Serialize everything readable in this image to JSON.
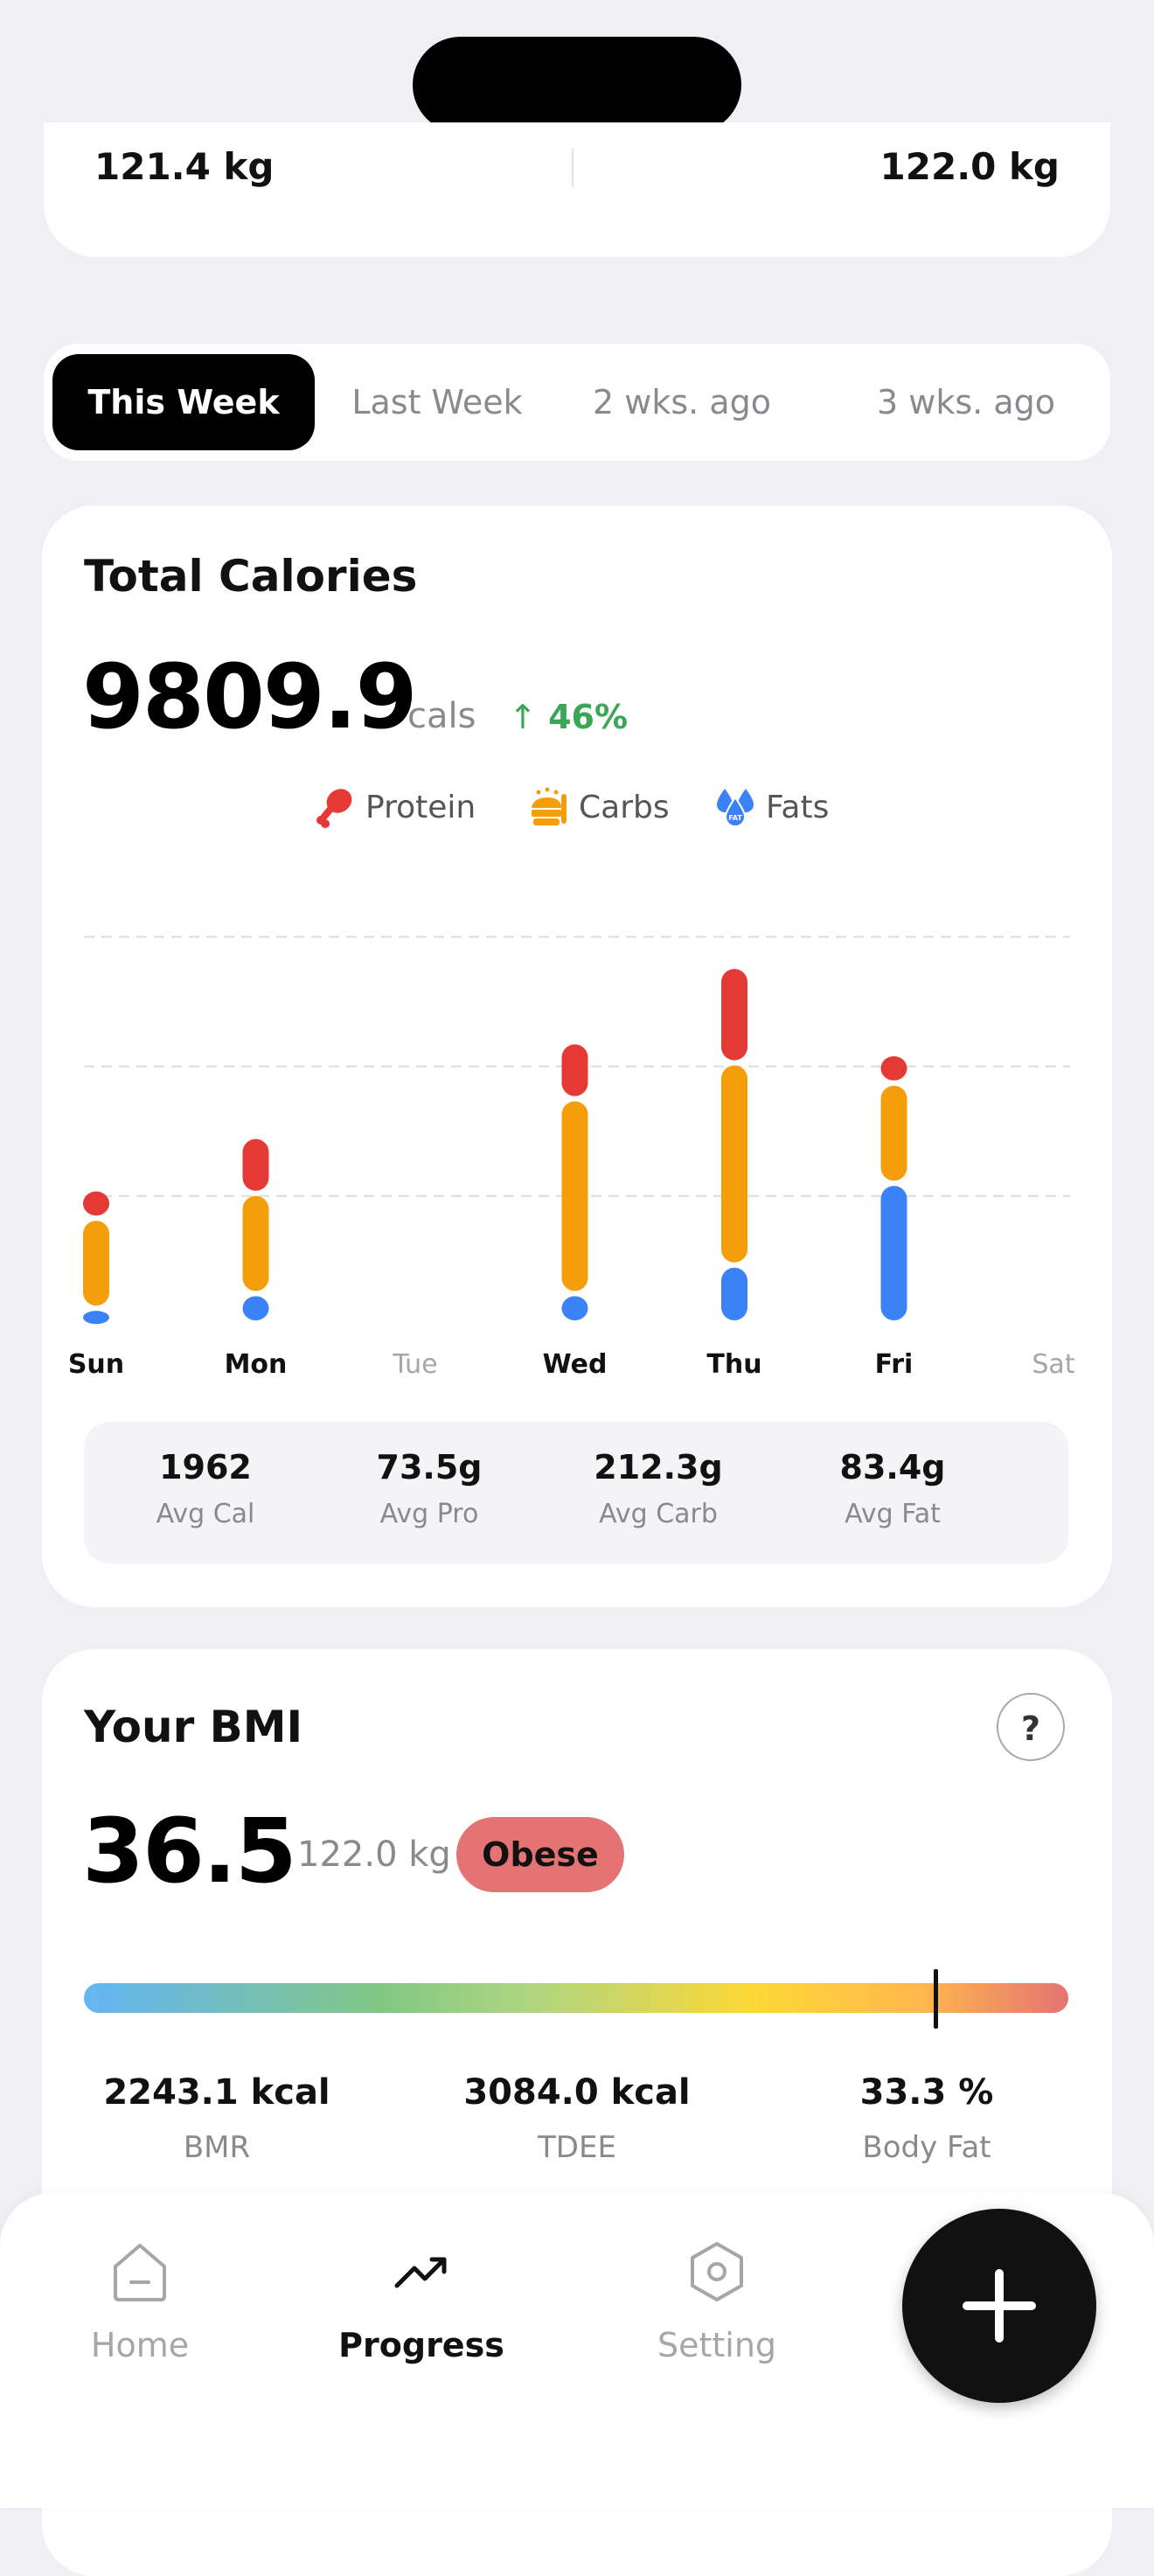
{
  "weight": {
    "left_value": "121.4 kg",
    "right_value": "122.0 kg"
  },
  "tabs": [
    {
      "label": "This Week",
      "active": true
    },
    {
      "label": "Last Week",
      "active": false
    },
    {
      "label": "2 wks. ago",
      "active": false
    },
    {
      "label": "3 wks. ago",
      "active": false
    }
  ],
  "calories": {
    "title": "Total Calories",
    "total": "9809.9",
    "unit": "cals",
    "delta": "46%",
    "delta_direction": "up",
    "legend": [
      {
        "label": "Protein",
        "icon": "drumstick-icon",
        "color": "#e53935"
      },
      {
        "label": "Carbs",
        "icon": "bread-icon",
        "color": "#f59e0b"
      },
      {
        "label": "Fats",
        "icon": "fat-drops-icon",
        "color": "#3b82f6"
      }
    ],
    "stats": [
      {
        "value": "1962",
        "label": "Avg Cal"
      },
      {
        "value": "73.5g",
        "label": "Avg Pro"
      },
      {
        "value": "212.3g",
        "label": "Avg Carb"
      },
      {
        "value": "83.4g",
        "label": "Avg Fat"
      }
    ]
  },
  "chart_data": {
    "type": "bar",
    "stacked": true,
    "categories": [
      "Sun",
      "Mon",
      "Tue",
      "Wed",
      "Thu",
      "Fri",
      "Sat"
    ],
    "series": [
      {
        "name": "Fats",
        "color": "#3b82f6",
        "values": [
          80,
          160,
          0,
          160,
          315,
          760
        ]
      },
      {
        "name": "Carbs",
        "color": "#f59e0b",
        "values": [
          490,
          545,
          0,
          1060,
          1100,
          545
        ]
      },
      {
        "name": "Protein",
        "color": "#e53935",
        "values": [
          160,
          310,
          0,
          310,
          525,
          160
        ]
      }
    ],
    "ylim": [
      0,
      2150
    ],
    "gridlines": [
      705,
      1410,
      2115
    ],
    "grid": true,
    "legend": "top-center"
  },
  "bmi": {
    "title": "Your BMI",
    "help_label": "?",
    "value": "36.5",
    "weight": "122.0 kg",
    "category": "Obese",
    "indicator_fraction": 0.865,
    "stats": [
      {
        "value": "2243.1 kcal",
        "label": "BMR"
      },
      {
        "value": "3084.0 kcal",
        "label": "TDEE"
      },
      {
        "value": "33.3 %",
        "label": "Body Fat"
      }
    ]
  },
  "nav": {
    "items": [
      {
        "label": "Home",
        "icon": "home-icon",
        "active": false
      },
      {
        "label": "Progress",
        "icon": "trend-up-icon",
        "active": true
      },
      {
        "label": "Setting",
        "icon": "settings-icon",
        "active": false
      }
    ],
    "fab_icon": "plus-icon"
  },
  "colors": {
    "accent": "#000000",
    "positive": "#3aa757",
    "obese": "#e57373"
  }
}
